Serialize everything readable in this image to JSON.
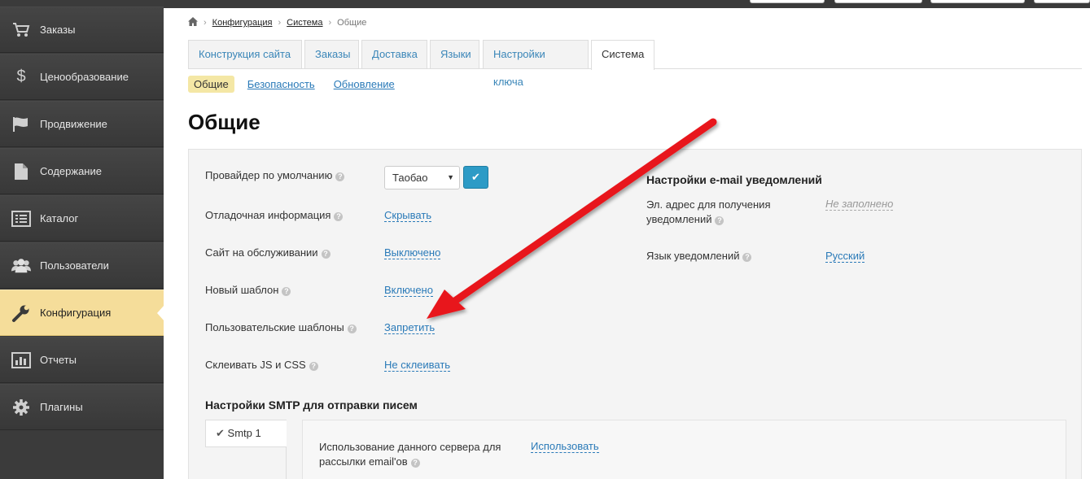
{
  "sidebar": {
    "items": [
      {
        "label": "Заказы",
        "icon": "cart-icon"
      },
      {
        "label": "Ценообразование",
        "icon": "dollar-icon"
      },
      {
        "label": "Продвижение",
        "icon": "flag-icon"
      },
      {
        "label": "Содержание",
        "icon": "document-icon"
      },
      {
        "label": "Каталог",
        "icon": "list-icon"
      },
      {
        "label": "Пользователи",
        "icon": "users-icon"
      },
      {
        "label": "Конфигурация",
        "icon": "wrench-icon"
      },
      {
        "label": "Отчеты",
        "icon": "bar-chart-icon"
      },
      {
        "label": "Плагины",
        "icon": "gear-icon"
      }
    ],
    "active_index": 6
  },
  "breadcrumb": {
    "items": [
      "Конфигурация",
      "Система",
      "Общие"
    ]
  },
  "tabs": [
    "Конструкция сайта",
    "Заказы",
    "Доставка",
    "Языки",
    "Настройки ключа",
    "Система"
  ],
  "subtabs": [
    "Общие",
    "Безопасность",
    "Обновление"
  ],
  "page_title": "Общие",
  "settings": {
    "provider": {
      "label": "Провайдер по умолчанию",
      "value": "Таобао"
    },
    "debug": {
      "label": "Отладочная информация",
      "value": "Скрывать"
    },
    "maintenance": {
      "label": "Сайт на обслуживании",
      "value": "Выключено"
    },
    "new_template": {
      "label": "Новый шаблон",
      "value": "Включено"
    },
    "user_templates": {
      "label": "Пользовательские шаблоны",
      "value": "Запретить"
    },
    "merge_js_css": {
      "label": "Склеивать JS и CSS",
      "value": "Не склеивать"
    }
  },
  "email_notifications": {
    "title": "Настройки e-mail уведомлений",
    "address_label_1": "Эл. адрес для получения",
    "address_label_2": "уведомлений",
    "address_value": "Не заполнено",
    "language_label": "Язык уведомлений",
    "language_value": "Русский"
  },
  "smtp": {
    "title": "Настройки SMTP для отправки писем",
    "tab_label": "Smtp 1",
    "use_label_1": "Использование данного сервера для",
    "use_label_2": "рассылки email'ов",
    "use_value": "Использовать"
  },
  "colors": {
    "sidebar_bg": "#3b3b3b",
    "active_item": "#f5dd9a",
    "link": "#2a7ab8",
    "ok_button": "#2d9bc6",
    "arrow": "#e8191c"
  }
}
